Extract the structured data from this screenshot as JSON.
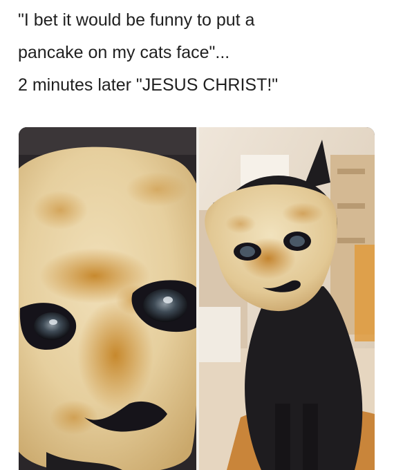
{
  "caption": {
    "line1": "\"I bet it would be funny to put a",
    "line2": "pancake on my cats face\"...",
    "line3": "2 minutes later \"JESUS CHRIST!\""
  },
  "photos": {
    "left_alt": "close-up of cat wearing pancake mask",
    "right_alt": "black cat sitting wearing pancake mask"
  },
  "colors": {
    "pancake": "#e8d3a6",
    "browned": "#c98f3a",
    "cat_fur": "#1e1c1f",
    "room_wall": "#e9dcc9"
  }
}
